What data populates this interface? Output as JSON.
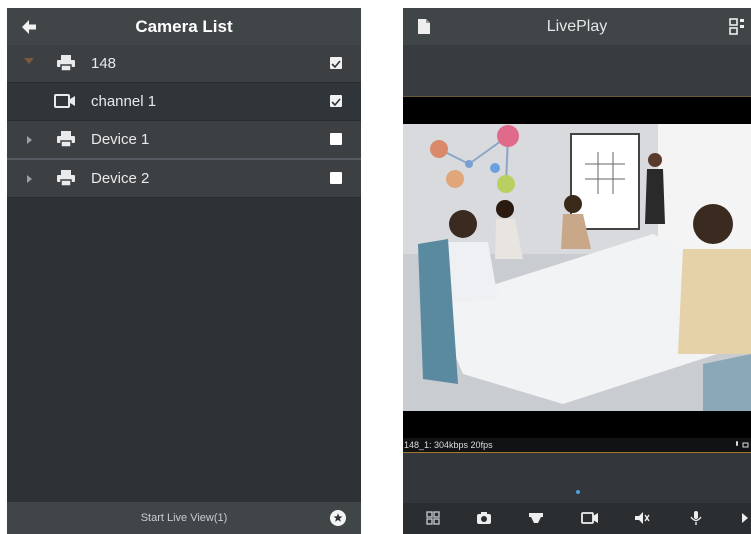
{
  "left_screen": {
    "title": "Camera List",
    "rows": [
      {
        "label": "148",
        "checked": true
      },
      {
        "label": "channel 1",
        "checked": true
      },
      {
        "label": "Device 1",
        "checked": false
      },
      {
        "label": "Device 2",
        "checked": false
      }
    ],
    "footer": {
      "start_label": "Start Live View(1)"
    }
  },
  "right_screen": {
    "title": "LivePlay",
    "stream_info": "148_1: 304kbps 20fps"
  },
  "colors": {
    "panel_bg": "#2e3235",
    "header_bg": "#404548",
    "expanded_arrow": "#7a5a3a",
    "stream_border": "#a07a2a",
    "page_dot": "#4aa3e0"
  },
  "icons": {
    "back": "arrow-left-icon",
    "device": "printer-icon",
    "channel": "video-camera-icon",
    "star": "star-icon",
    "document": "document-icon",
    "layout": "layout-icon",
    "toolbar": [
      "grid-icon",
      "snapshot-icon",
      "ptz-icon",
      "record-icon",
      "mute-icon",
      "microphone-icon",
      "next-icon"
    ]
  }
}
